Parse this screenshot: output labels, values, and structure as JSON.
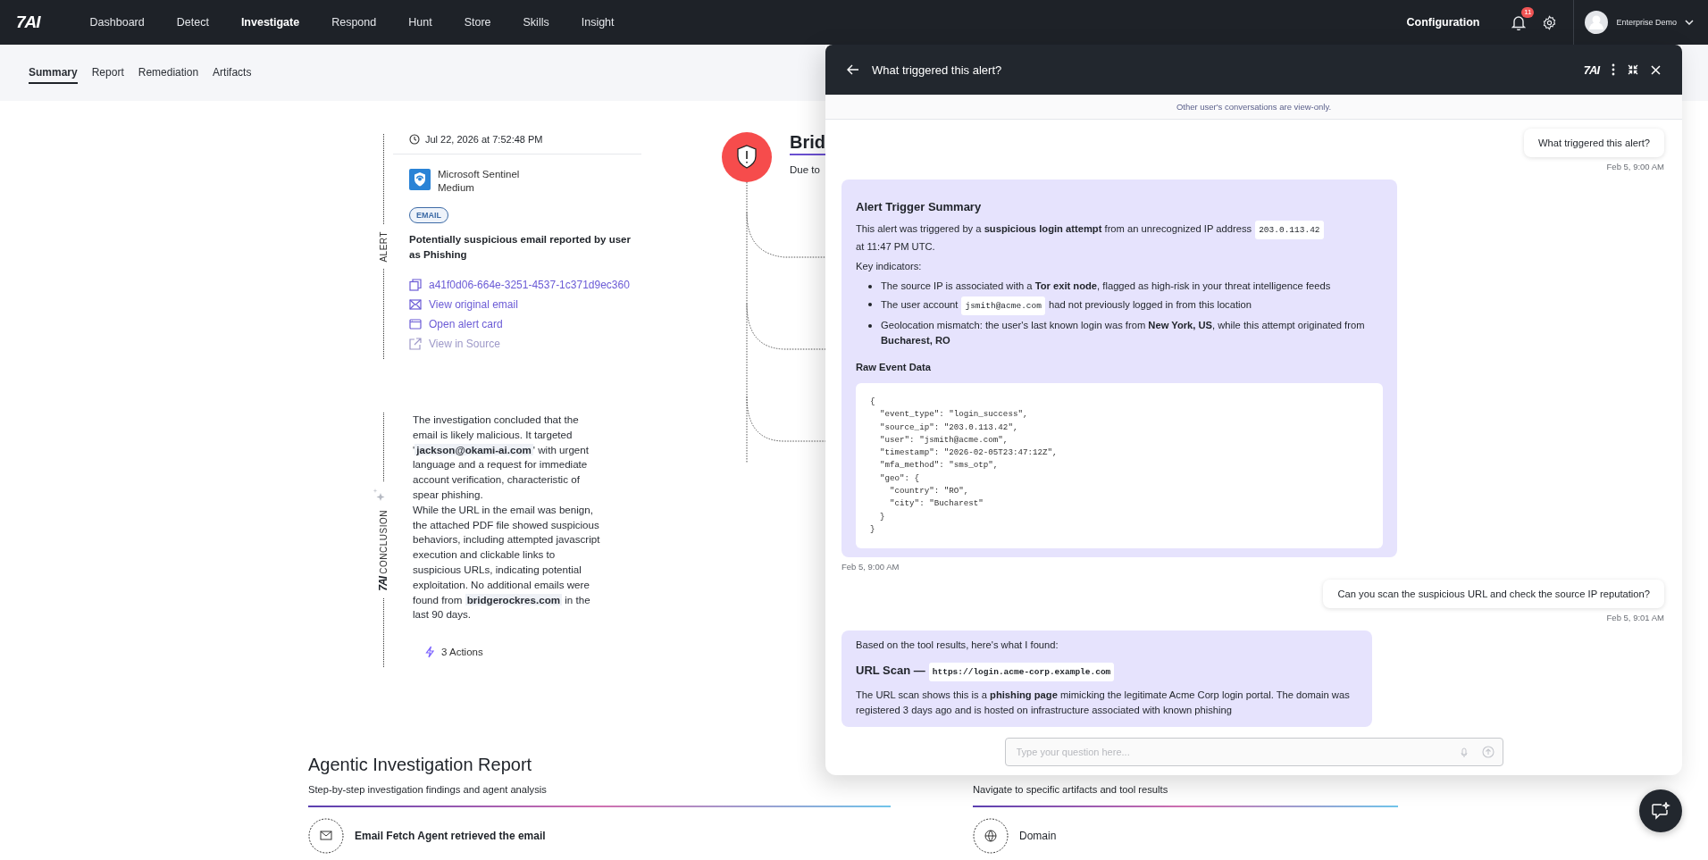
{
  "nav": {
    "logo": "7AI",
    "items": [
      {
        "label": "Dashboard",
        "selected": false
      },
      {
        "label": "Detect",
        "selected": false
      },
      {
        "label": "Investigate",
        "selected": true
      },
      {
        "label": "Respond",
        "selected": false
      },
      {
        "label": "Hunt",
        "selected": false
      },
      {
        "label": "Store",
        "selected": false
      },
      {
        "label": "Skills",
        "selected": false
      },
      {
        "label": "Insight",
        "selected": false
      }
    ],
    "configuration": "Configuration",
    "notifications": "11",
    "user": "Enterprise Demo"
  },
  "subtabs": [
    {
      "label": "Summary",
      "selected": true
    },
    {
      "label": "Report",
      "selected": false
    },
    {
      "label": "Remediation",
      "selected": false
    },
    {
      "label": "Artifacts",
      "selected": false
    }
  ],
  "alert": {
    "section_label": "ALERT",
    "timestamp": "Jul 22, 2026 at 7:52:48 PM",
    "source": "Microsoft Sentinel",
    "severity": "Medium",
    "tag": "EMAIL",
    "title": "Potentially suspicious email reported by user as Phishing",
    "links": [
      {
        "kind": "copy",
        "label": "a41f0d06-664e-3251-4537-1c371d9ec360",
        "disabled": false
      },
      {
        "kind": "mail",
        "label": "View original email",
        "disabled": false
      },
      {
        "kind": "card",
        "label": "Open alert card",
        "disabled": false
      },
      {
        "kind": "external",
        "label": "View in Source",
        "disabled": true
      }
    ]
  },
  "conclusion": {
    "logo": "7AI",
    "section_label": "CONCLUSION",
    "paragraphs": [
      "The investigation concluded that the email is likely malicious. It targeted '**jackson@okami-ai.com**' with urgent language and a request for immediate account verification, characteristic of spear phishing.",
      "While the URL in the email was benign, the attached PDF file showed suspicious behaviors, including attempted javascript execution and clickable links to suspicious URLs, indicating potential exploitation. No additional emails were found from **bridgerockres.com** in the last 90 days."
    ],
    "actions": "3 Actions"
  },
  "graph": {
    "title": "Brid",
    "subtitle": "Due to"
  },
  "report": {
    "title": "Agentic Investigation Report",
    "subtitle": "Step-by-step investigation findings and agent analysis",
    "first_step": "Email Fetch Agent retrieved the email"
  },
  "navigate": {
    "subtitle": "Navigate to specific artifacts and tool results",
    "first_item": "Domain"
  },
  "chat": {
    "title": "What triggered this alert?",
    "logo": "7AI",
    "notice": "Other user's conversations are view-only.",
    "messages": [
      {
        "kind": "user",
        "text": "What triggered this alert?",
        "time": "Feb 5, 9:00 AM"
      },
      {
        "kind": "assistant",
        "time": "Feb 5, 9:00 AM",
        "blocks": [
          {
            "kind": "heading",
            "parts": [
              {
                "text": "Alert Trigger Summary"
              }
            ]
          },
          {
            "kind": "paragraph",
            "parts": [
              {
                "text": "This alert was triggered by a **suspicious login attempt** from an unrecognized IP address "
              },
              {
                "code": "203.0.113.42"
              },
              {
                "text": " at 11:47 PM UTC."
              }
            ]
          },
          {
            "kind": "paragraph",
            "parts": [
              {
                "text": "Key indicators:"
              }
            ]
          },
          {
            "kind": "bullets",
            "items": [
              [
                {
                  "text": "The source IP is associated with a **Tor exit node**, flagged as high-risk in your threat intelligence feeds"
                }
              ],
              [
                {
                  "text": "The user account "
                },
                {
                  "code": "jsmith@acme.com"
                },
                {
                  "text": " had not previously logged in from this location"
                }
              ],
              [
                {
                  "text": "Geolocation mismatch: the user's last known login was from **New York, US**, while this attempt originated from **Bucharest, RO**"
                }
              ]
            ]
          },
          {
            "kind": "subheading",
            "parts": [
              {
                "text": "Raw Event Data"
              }
            ]
          },
          {
            "kind": "code",
            "code": "{\n  \"event_type\": \"login_success\",\n  \"source_ip\": \"203.0.113.42\",\n  \"user\": \"jsmith@acme.com\",\n  \"timestamp\": \"2026-02-05T23:47:12Z\",\n  \"mfa_method\": \"sms_otp\",\n  \"geo\": {\n    \"country\": \"RO\",\n    \"city\": \"Bucharest\"\n  }\n}"
          }
        ]
      },
      {
        "kind": "user",
        "text": "Can you scan the suspicious URL and check the source IP reputation?",
        "time": "Feb 5, 9:01 AM"
      },
      {
        "kind": "assistant",
        "blocks": [
          {
            "kind": "paragraph",
            "parts": [
              {
                "text": "Based on the tool results, here's what I found:"
              }
            ]
          },
          {
            "kind": "heading",
            "parts": [
              {
                "text": "URL Scan — "
              },
              {
                "code": "https://login.acme-corp.example.com"
              }
            ]
          },
          {
            "kind": "paragraph",
            "parts": [
              {
                "text": "The URL scan shows this is a **phishing page** mimicking the legitimate Acme Corp login portal. The domain was registered 3 days ago and is hosted on infrastructure associated with known phishing"
              }
            ]
          }
        ]
      }
    ],
    "input": {
      "placeholder": "Type your question here..."
    }
  }
}
